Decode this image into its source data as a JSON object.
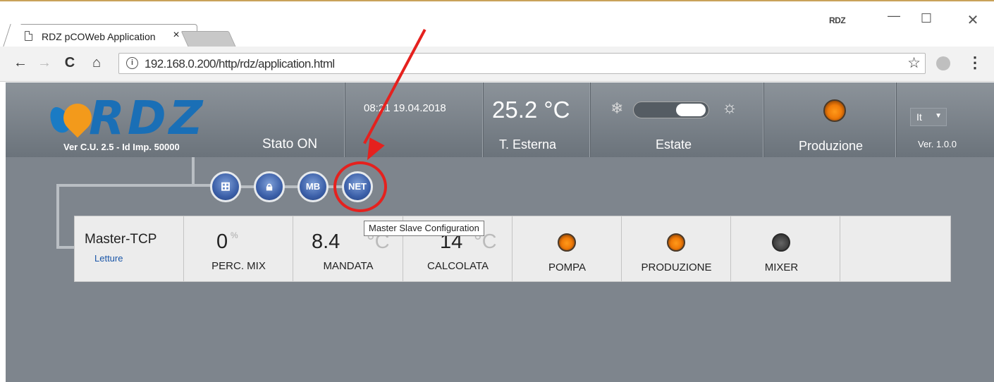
{
  "browser": {
    "tab_title": "RDZ pCOWeb Application",
    "tab_close": "×",
    "window_user": "RDZ",
    "url": "192.168.0.200/http/rdz/application.html",
    "controls": {
      "minimize": "—",
      "maximize": "☐",
      "close": "✕"
    },
    "nav": {
      "back": "←",
      "forward": "→",
      "reload": "C",
      "home": "⌂",
      "star": "☆",
      "menu": "⋮"
    }
  },
  "header": {
    "logo_text": "RDZ",
    "ver_cu": "Ver C.U. 2.5 - Id Imp. 50000",
    "stato": "Stato ON",
    "datetime": "08:21 19.04.2018",
    "temperature": "25.2 °C",
    "temperature_label": "T. Esterna",
    "season_label": "Estate",
    "season_toggle": "estate",
    "production_label": "Produzione",
    "language": "It",
    "version": "Ver. 1.0.0",
    "icons": {
      "winter": "snowflake-icon",
      "summer": "sun-icon"
    },
    "colors": {
      "accent": "#1a6fb6",
      "led_orange": "#f07b08",
      "annotation_red": "#e5211e"
    }
  },
  "toolbar_buttons": [
    {
      "icon": "network-icon",
      "label": ""
    },
    {
      "icon": "lock-icon",
      "label": ""
    },
    {
      "icon": "modbus-icon",
      "label": "MB"
    },
    {
      "icon": "net-icon",
      "label": "NET"
    }
  ],
  "tooltip": "Master Slave Configuration",
  "panel": {
    "name": "Master-TCP",
    "link": "Letture",
    "perc_mix": {
      "value": "0",
      "unit": "%",
      "label": "PERC. MIX"
    },
    "mandata": {
      "value": "8.4",
      "unit": "°C",
      "label": "MANDATA"
    },
    "calcolata": {
      "value": "14",
      "unit": "°C",
      "label": "CALCOLATA"
    },
    "pompa": {
      "label": "POMPA",
      "state": "on"
    },
    "produzione": {
      "label": "PRODUZIONE",
      "state": "on"
    },
    "mixer": {
      "label": "MIXER",
      "state": "off"
    }
  }
}
